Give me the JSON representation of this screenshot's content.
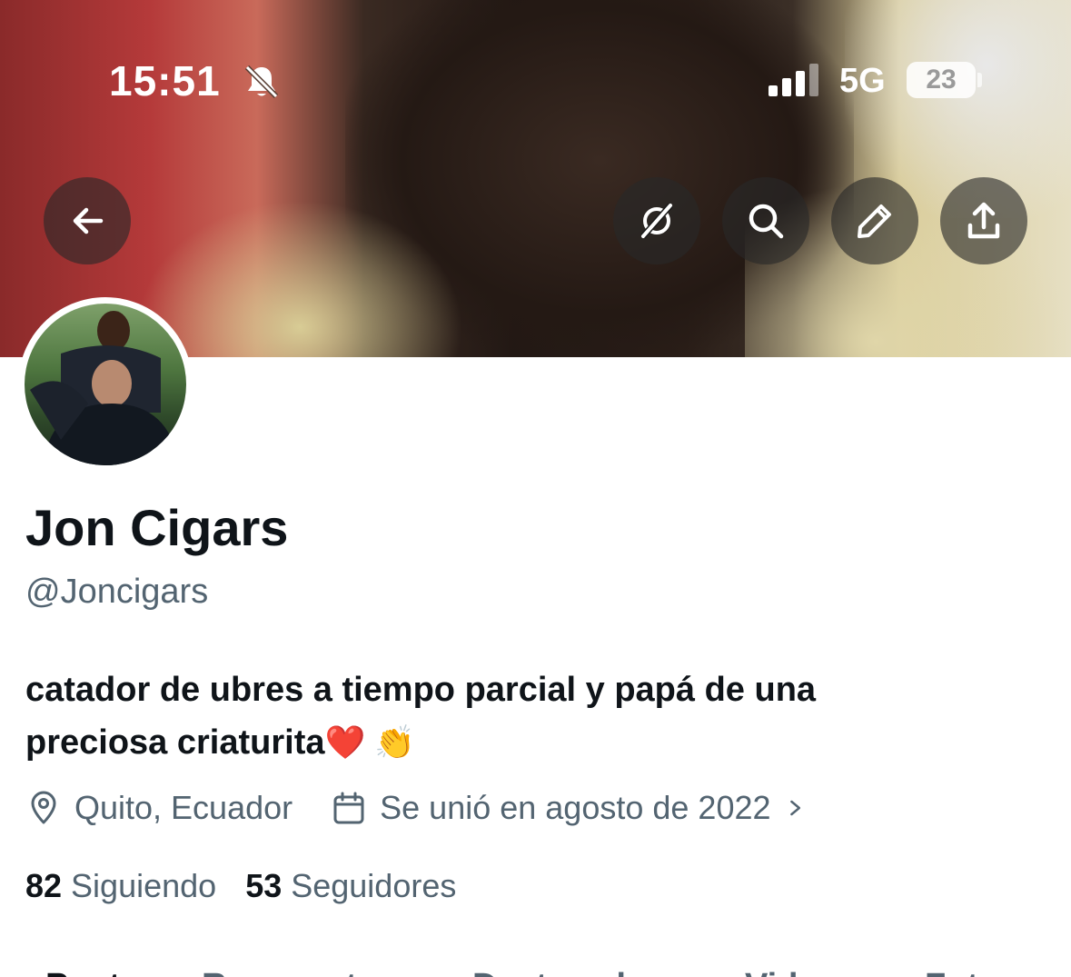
{
  "status_bar": {
    "time": "15:51",
    "network": "5G",
    "battery": "23",
    "icons": [
      "bell-slash-icon",
      "signal-icon"
    ]
  },
  "header": {
    "buttons": [
      {
        "name": "back-button",
        "icon": "arrow-left-icon"
      },
      {
        "name": "grok-button",
        "icon": "grok-icon"
      },
      {
        "name": "search-button",
        "icon": "search-icon"
      },
      {
        "name": "edit-button",
        "icon": "pencil-icon"
      },
      {
        "name": "share-button",
        "icon": "share-icon"
      }
    ]
  },
  "profile": {
    "name": "Jon Cigars",
    "handle": "@Joncigars",
    "bio_line1": "catador de ubres a tiempo parcial y papá de una",
    "bio_line2": "preciosa criaturita",
    "bio_emoji": "❤️ 👏",
    "location": "Quito, Ecuador",
    "joined": "Se unió en agosto de 2022"
  },
  "stats": {
    "following_count": "82",
    "following_label": "Siguiendo",
    "followers_count": "53",
    "followers_label": "Seguidores"
  },
  "tabs": [
    "Posts",
    "Respuestas",
    "Destacados",
    "Videos",
    "Fotos"
  ],
  "colors": {
    "text_primary": "#0f1419",
    "text_secondary": "#536471",
    "background": "#ffffff"
  }
}
